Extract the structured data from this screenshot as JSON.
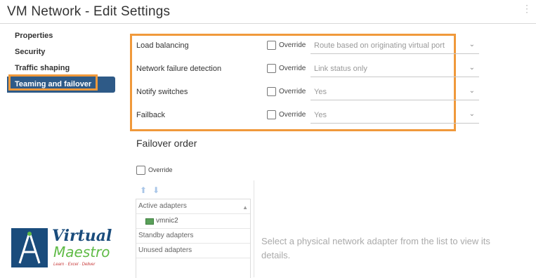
{
  "window": {
    "title": "VM Network - Edit Settings"
  },
  "sidebar": {
    "items": [
      {
        "label": "Properties"
      },
      {
        "label": "Security"
      },
      {
        "label": "Traffic shaping"
      },
      {
        "label": "Teaming and failover",
        "active": true
      }
    ]
  },
  "settings": {
    "override_label": "Override",
    "rows": [
      {
        "label": "Load balancing",
        "value": "Route based on originating virtual port"
      },
      {
        "label": "Network failure detection",
        "value": "Link status only"
      },
      {
        "label": "Notify switches",
        "value": "Yes"
      },
      {
        "label": "Failback",
        "value": "Yes"
      }
    ]
  },
  "failover": {
    "title": "Failover order",
    "override_label": "Override",
    "groups": {
      "active": "Active adapters",
      "active_nic": "vmnic2",
      "standby": "Standby adapters",
      "unused": "Unused adapters"
    },
    "detail_hint": "Select a physical network adapter from the list to view its details."
  },
  "logo": {
    "word1": "Virtual",
    "word2": "Maestro",
    "tagline": "Learn · Excel · Deliver"
  },
  "colors": {
    "highlight": "#f0993b",
    "nav_active": "#2e5a87"
  }
}
